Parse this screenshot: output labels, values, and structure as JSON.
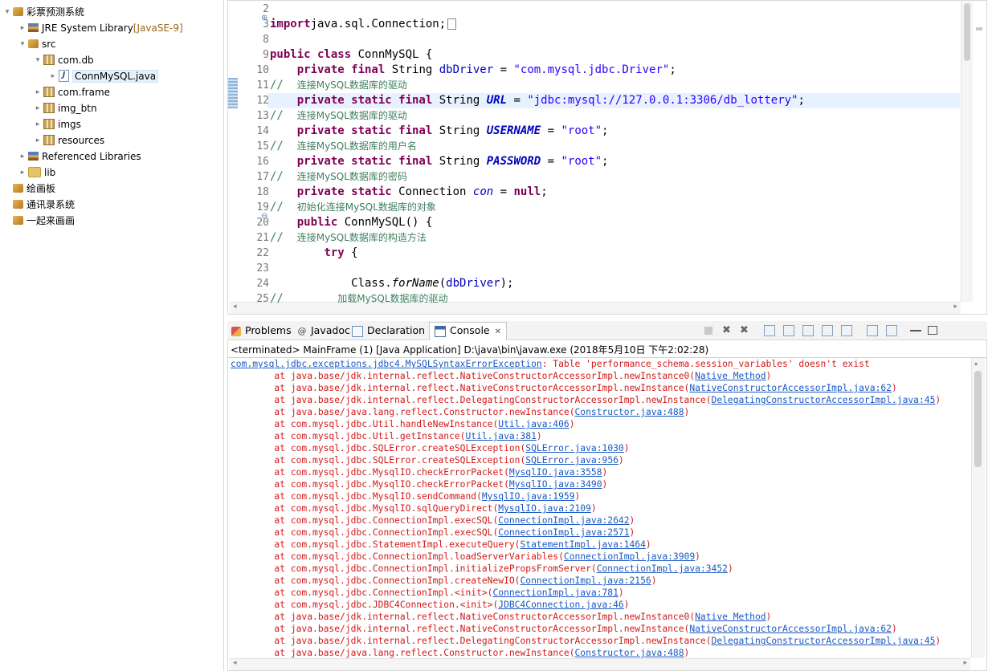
{
  "explorer": {
    "items": [
      {
        "label": "彩票预测系统",
        "depth": 0,
        "twisty": "▾",
        "icon": "project-icon"
      },
      {
        "label": "JRE System Library",
        "extra": "[JavaSE-9]",
        "depth": 1,
        "twisty": "▸",
        "icon": "library-icon"
      },
      {
        "label": "src",
        "depth": 1,
        "twisty": "▾",
        "icon": "source-folder-icon"
      },
      {
        "label": "com.db",
        "depth": 2,
        "twisty": "▾",
        "icon": "package-icon"
      },
      {
        "label": "ConnMySQL.java",
        "depth": 3,
        "twisty": "▸",
        "icon": "java-file-icon",
        "selected": true
      },
      {
        "label": "com.frame",
        "depth": 2,
        "twisty": "▸",
        "icon": "package-icon"
      },
      {
        "label": "img_btn",
        "depth": 2,
        "twisty": "▸",
        "icon": "package-icon"
      },
      {
        "label": "imgs",
        "depth": 2,
        "twisty": "▸",
        "icon": "package-icon"
      },
      {
        "label": "resources",
        "depth": 2,
        "twisty": "▸",
        "icon": "package-icon"
      },
      {
        "label": "Referenced Libraries",
        "depth": 1,
        "twisty": "▸",
        "icon": "library-icon"
      },
      {
        "label": "lib",
        "depth": 1,
        "twisty": "▸",
        "icon": "folder-icon"
      },
      {
        "label": "绘画板",
        "depth": 0,
        "twisty": "",
        "icon": "project-icon"
      },
      {
        "label": "通讯录系统",
        "depth": 0,
        "twisty": "",
        "icon": "project-icon"
      },
      {
        "label": "一起来画画",
        "depth": 0,
        "twisty": "",
        "icon": "project-icon"
      }
    ]
  },
  "editor": {
    "lines": [
      {
        "n": "2",
        "html": ""
      },
      {
        "n": "3",
        "marker": "⊕",
        "parts": [
          [
            "kw",
            "import"
          ],
          [
            "",
            "java.sql.Connection;"
          ]
        ],
        "box": true
      },
      {
        "n": "8",
        "parts": []
      },
      {
        "n": "9",
        "parts": [
          [
            "kw",
            "public class"
          ],
          [
            "",
            " ConnMySQL {"
          ]
        ]
      },
      {
        "n": "10",
        "parts": [
          [
            "",
            "    "
          ],
          [
            "kw",
            "private final"
          ],
          [
            "",
            " String "
          ],
          [
            "fld",
            "dbDriver"
          ],
          [
            "",
            " = "
          ],
          [
            "str",
            "\"com.mysql.jdbc.Driver\""
          ],
          [
            "",
            ";"
          ]
        ]
      },
      {
        "n": "11",
        "parts": [
          [
            "cmt",
            "//  "
          ],
          [
            "cmtcjk",
            "连接MySQL数据库的驱动"
          ]
        ]
      },
      {
        "n": "12",
        "parts": [
          [
            "",
            "    "
          ],
          [
            "kw",
            "private static final"
          ],
          [
            "",
            " String "
          ],
          [
            "sfld",
            "URL"
          ],
          [
            "",
            " = "
          ],
          [
            "str",
            "\"jdbc:mysql://127.0.0.1:3306/db_lottery\""
          ],
          [
            "",
            ";"
          ]
        ],
        "current": true
      },
      {
        "n": "13",
        "parts": [
          [
            "cmt",
            "//  "
          ],
          [
            "cmtcjk",
            "连接MySQL数据库的驱动"
          ]
        ]
      },
      {
        "n": "14",
        "parts": [
          [
            "",
            "    "
          ],
          [
            "kw",
            "private static final"
          ],
          [
            "",
            " String "
          ],
          [
            "sfld",
            "USERNAME"
          ],
          [
            "",
            " = "
          ],
          [
            "str",
            "\"root\""
          ],
          [
            "",
            ";"
          ]
        ]
      },
      {
        "n": "15",
        "parts": [
          [
            "cmt",
            "//  "
          ],
          [
            "cmtcjk",
            "连接MySQL数据库的用户名"
          ]
        ]
      },
      {
        "n": "16",
        "parts": [
          [
            "",
            "    "
          ],
          [
            "kw",
            "private static final"
          ],
          [
            "",
            " String "
          ],
          [
            "sfld",
            "PASSWORD"
          ],
          [
            "",
            " = "
          ],
          [
            "str",
            "\"root\""
          ],
          [
            "",
            ";"
          ]
        ]
      },
      {
        "n": "17",
        "parts": [
          [
            "cmt",
            "//  "
          ],
          [
            "cmtcjk",
            "连接MySQL数据库的密码"
          ]
        ]
      },
      {
        "n": "18",
        "parts": [
          [
            "",
            "    "
          ],
          [
            "kw",
            "private static"
          ],
          [
            "",
            " Connection "
          ],
          [
            "ifld",
            "con"
          ],
          [
            "",
            " = "
          ],
          [
            "kw",
            "null"
          ],
          [
            "",
            ";"
          ]
        ]
      },
      {
        "n": "19",
        "parts": [
          [
            "cmt",
            "//  "
          ],
          [
            "cmtcjk",
            "初始化连接MySQL数据库的对象"
          ]
        ]
      },
      {
        "n": "20",
        "marker": "⊖",
        "parts": [
          [
            "",
            "    "
          ],
          [
            "kw",
            "public"
          ],
          [
            "",
            " ConnMySQL() {"
          ]
        ]
      },
      {
        "n": "21",
        "parts": [
          [
            "cmt",
            "//  "
          ],
          [
            "cmtcjk",
            "连接MySQL数据库的构造方法"
          ]
        ]
      },
      {
        "n": "22",
        "parts": [
          [
            "",
            "        "
          ],
          [
            "kw",
            "try"
          ],
          [
            "",
            " {"
          ]
        ]
      },
      {
        "n": "23",
        "parts": []
      },
      {
        "n": "24",
        "parts": [
          [
            "",
            "            Class."
          ],
          [
            "it",
            "forName"
          ],
          [
            "",
            "("
          ],
          [
            "fld",
            "dbDriver"
          ],
          [
            "",
            ");"
          ]
        ]
      },
      {
        "n": "25",
        "parts": [
          [
            "cmt",
            "//        "
          ],
          [
            "cmtcjk",
            "加载MySQL数据库的驱动"
          ]
        ]
      }
    ]
  },
  "console": {
    "tabs": [
      {
        "label": "Problems",
        "icon": "problems-icon"
      },
      {
        "label": "Javadoc",
        "icon": "at-icon"
      },
      {
        "label": "Declaration",
        "icon": "declaration-icon"
      },
      {
        "label": "Console",
        "icon": "console-icon",
        "active": true
      }
    ],
    "header": "<terminated> MainFrame (1) [Java Application] D:\\java\\bin\\javaw.exe (2018年5月10日 下午2:02:28)",
    "lines": [
      {
        "link": "com.mysql.jdbc.exceptions.jdbc4.MySQLSyntaxErrorException",
        "text": ": Table 'performance_schema.session_variables' doesn't exist",
        "indent": false
      },
      {
        "text": "at java.base/jdk.internal.reflect.NativeConstructorAccessorImpl.newInstance0(",
        "link": "Native Method",
        "tail": ")"
      },
      {
        "text": "at java.base/jdk.internal.reflect.NativeConstructorAccessorImpl.newInstance(",
        "link": "NativeConstructorAccessorImpl.java:62",
        "tail": ")"
      },
      {
        "text": "at java.base/jdk.internal.reflect.DelegatingConstructorAccessorImpl.newInstance(",
        "link": "DelegatingConstructorAccessorImpl.java:45",
        "tail": ")"
      },
      {
        "text": "at java.base/java.lang.reflect.Constructor.newInstance(",
        "link": "Constructor.java:488",
        "tail": ")"
      },
      {
        "text": "at com.mysql.jdbc.Util.handleNewInstance(",
        "link": "Util.java:406",
        "tail": ")"
      },
      {
        "text": "at com.mysql.jdbc.Util.getInstance(",
        "link": "Util.java:381",
        "tail": ")"
      },
      {
        "text": "at com.mysql.jdbc.SQLError.createSQLException(",
        "link": "SQLError.java:1030",
        "tail": ")"
      },
      {
        "text": "at com.mysql.jdbc.SQLError.createSQLException(",
        "link": "SQLError.java:956",
        "tail": ")"
      },
      {
        "text": "at com.mysql.jdbc.MysqlIO.checkErrorPacket(",
        "link": "MysqlIO.java:3558",
        "tail": ")"
      },
      {
        "text": "at com.mysql.jdbc.MysqlIO.checkErrorPacket(",
        "link": "MysqlIO.java:3490",
        "tail": ")"
      },
      {
        "text": "at com.mysql.jdbc.MysqlIO.sendCommand(",
        "link": "MysqlIO.java:1959",
        "tail": ")"
      },
      {
        "text": "at com.mysql.jdbc.MysqlIO.sqlQueryDirect(",
        "link": "MysqlIO.java:2109",
        "tail": ")"
      },
      {
        "text": "at com.mysql.jdbc.ConnectionImpl.execSQL(",
        "link": "ConnectionImpl.java:2642",
        "tail": ")"
      },
      {
        "text": "at com.mysql.jdbc.ConnectionImpl.execSQL(",
        "link": "ConnectionImpl.java:2571",
        "tail": ")"
      },
      {
        "text": "at com.mysql.jdbc.StatementImpl.executeQuery(",
        "link": "StatementImpl.java:1464",
        "tail": ")"
      },
      {
        "text": "at com.mysql.jdbc.ConnectionImpl.loadServerVariables(",
        "link": "ConnectionImpl.java:3909",
        "tail": ")"
      },
      {
        "text": "at com.mysql.jdbc.ConnectionImpl.initializePropsFromServer(",
        "link": "ConnectionImpl.java:3452",
        "tail": ")"
      },
      {
        "text": "at com.mysql.jdbc.ConnectionImpl.createNewIO(",
        "link": "ConnectionImpl.java:2156",
        "tail": ")"
      },
      {
        "text": "at com.mysql.jdbc.ConnectionImpl.<init>(",
        "link": "ConnectionImpl.java:781",
        "tail": ")"
      },
      {
        "text": "at com.mysql.jdbc.JDBC4Connection.<init>(",
        "link": "JDBC4Connection.java:46",
        "tail": ")"
      },
      {
        "text": "at java.base/jdk.internal.reflect.NativeConstructorAccessorImpl.newInstance0(",
        "link": "Native Method",
        "tail": ")"
      },
      {
        "text": "at java.base/jdk.internal.reflect.NativeConstructorAccessorImpl.newInstance(",
        "link": "NativeConstructorAccessorImpl.java:62",
        "tail": ")"
      },
      {
        "text": "at java.base/jdk.internal.reflect.DelegatingConstructorAccessorImpl.newInstance(",
        "link": "DelegatingConstructorAccessorImpl.java:45",
        "tail": ")"
      },
      {
        "text": "at java.base/java.lang.reflect.Constructor.newInstance(",
        "link": "Constructor.java:488",
        "tail": ")"
      }
    ]
  },
  "colors": {
    "keyword": "#7f0055",
    "string": "#2a00ff",
    "field": "#0000c0",
    "comment": "#3f7f5f",
    "error": "#d11a1a",
    "link": "#1a58c4",
    "current_line": "#e8f2fe"
  }
}
